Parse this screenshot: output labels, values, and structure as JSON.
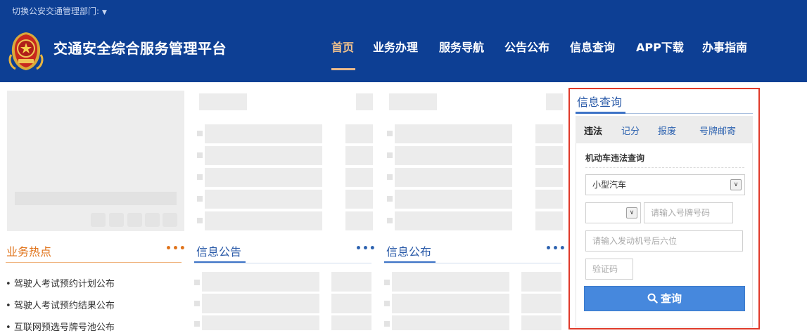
{
  "topbar": {
    "switch_label": "切换公安交通管理部门:",
    "caret_icon": "caret-down-icon"
  },
  "header": {
    "site_title": "交通安全综合服务管理平台",
    "emblem_icon": "police-emblem-icon"
  },
  "nav": {
    "active": "首页",
    "items": [
      {
        "label": "首页"
      },
      {
        "label": "业务办理"
      },
      {
        "label": "服务导航"
      },
      {
        "label": "公告公布"
      },
      {
        "label": "信息查询"
      },
      {
        "label": "APP下载"
      },
      {
        "label": "办事指南"
      }
    ]
  },
  "sections": {
    "hot": {
      "title": "业务热点",
      "more": "•••",
      "items": [
        "驾驶人考试预约计划公布",
        "驾驶人考试预约结果公布",
        "互联网预选号牌号池公布"
      ]
    },
    "notice": {
      "title": "信息公告",
      "more": "•••"
    },
    "publish": {
      "title": "信息公布",
      "more": "•••"
    }
  },
  "query": {
    "title": "信息查询",
    "tabs": [
      "违法",
      "记分",
      "报废",
      "号牌邮寄"
    ],
    "active_tab": "违法",
    "subtitle": "机动车违法查询",
    "vehicle_type": "小型汽车",
    "plate_prefix": "",
    "plate_placeholder": "请输入号牌号码",
    "engine_placeholder": "请输入发动机号后六位",
    "captcha_placeholder": "验证码",
    "button_label": "查询",
    "button_icon": "search-icon"
  },
  "colors": {
    "header_bg": "#0d3f94",
    "nav_active": "#f2c28c",
    "hot_accent": "#e0741c",
    "link_blue": "#2e63b0",
    "highlight_border": "#e03a2a",
    "button_bg": "#4688dd"
  }
}
